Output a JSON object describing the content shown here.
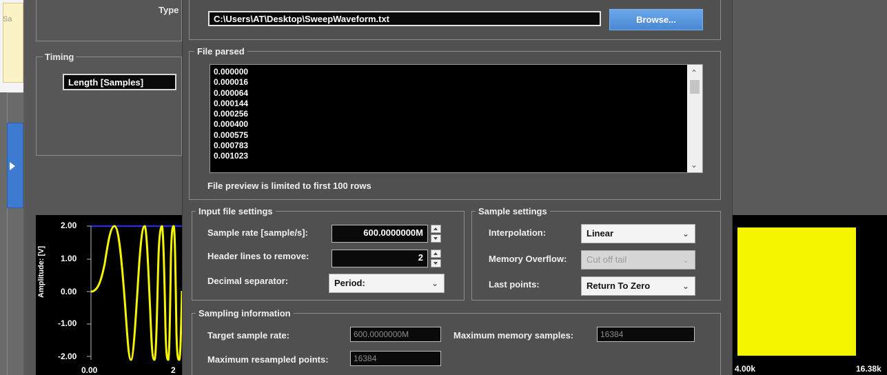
{
  "background_app": {
    "tab_partial_label": "Sa",
    "type_label": "Type",
    "timing_title": "Timing",
    "length_field": "Length [Samples]",
    "chart_left": {
      "ylabel": "Amplitude: [V]",
      "y_ticks": [
        "2.00",
        "1.00",
        "0.00",
        "-1.00",
        "-2.00"
      ],
      "x_ticks": [
        "0.00",
        "2"
      ]
    },
    "chart_right": {
      "x_ticks": [
        "4.00k",
        "16.38k"
      ]
    }
  },
  "dialog": {
    "file_path": "C:\\Users\\AT\\Desktop\\SweepWaveform.txt",
    "browse_label": "Browse...",
    "file_parsed": {
      "title": "File parsed",
      "rows": [
        "0.000000",
        "0.000016",
        "0.000064",
        "0.000144",
        "0.000256",
        "0.000400",
        "0.000575",
        "0.000783",
        "0.001023"
      ],
      "hint": "File preview is limited to first 100 rows"
    },
    "input_file_settings": {
      "title": "Input file settings",
      "sample_rate_label": "Sample rate [sample/s]:",
      "sample_rate_value": "600.0000000M",
      "header_lines_label": "Header lines to remove:",
      "header_lines_value": "2",
      "decimal_separator_label": "Decimal separator:",
      "decimal_separator_value": "Period:"
    },
    "sample_settings": {
      "title": "Sample settings",
      "interpolation_label": "Interpolation:",
      "interpolation_value": "Linear",
      "memory_overflow_label": "Memory Overflow:",
      "memory_overflow_value": "Cut off tail",
      "last_points_label": "Last points:",
      "last_points_value": "Return To Zero"
    },
    "sampling_information": {
      "title": "Sampling information",
      "target_rate_label": "Target sample rate:",
      "target_rate_value": "600.0000000M",
      "max_memory_label": "Maximum memory samples:",
      "max_memory_value": "16384",
      "max_resampled_label": "Maximum resampled points:",
      "max_resampled_value": "16384"
    }
  },
  "colors": {
    "browse_blue": "#4a87d3",
    "waveform_yellow": "#f5f500",
    "panel_gray": "#505050"
  }
}
